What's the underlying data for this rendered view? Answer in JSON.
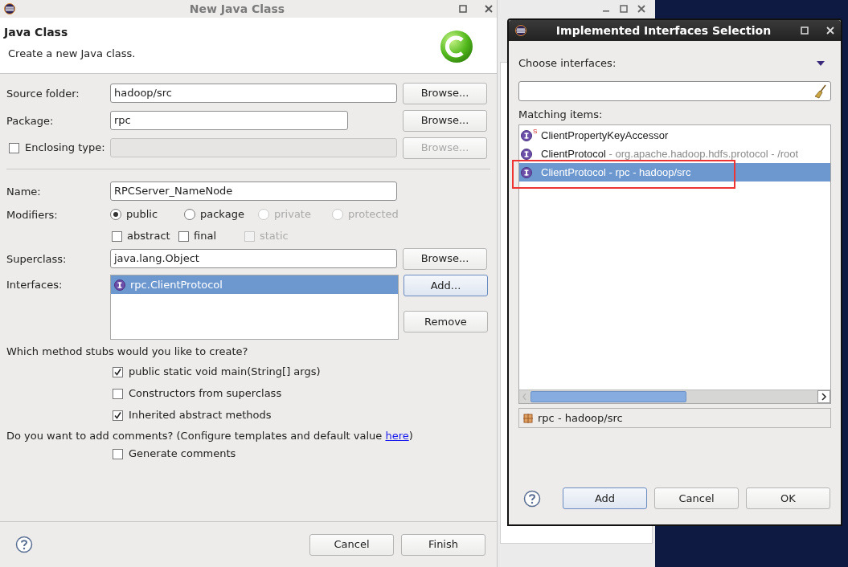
{
  "main_dialog": {
    "title": "New Java Class",
    "header": {
      "title": "Java Class",
      "description": "Create a new Java class."
    },
    "source_folder": {
      "label": "Source folder:",
      "value": "hadoop/src",
      "button": {
        "label": "Browse...",
        "disabled": false,
        "focused": false
      }
    },
    "package": {
      "label": "Package:",
      "value": "rpc",
      "button": {
        "label": "Browse...",
        "disabled": false,
        "focused": false
      }
    },
    "enclosing_type": {
      "label": "Enclosing type:",
      "checked": false,
      "disabled": true,
      "button": {
        "label": "Browse...",
        "disabled": true,
        "focused": false
      }
    },
    "name": {
      "label": "Name:",
      "value": "RPCServer_NameNode"
    },
    "modifiers": {
      "label": "Modifiers:",
      "access": [
        {
          "label": "public",
          "selected": true,
          "disabled": false
        },
        {
          "label": "package",
          "selected": false,
          "disabled": false
        },
        {
          "label": "private",
          "selected": false,
          "disabled": true
        },
        {
          "label": "protected",
          "selected": false,
          "disabled": true
        }
      ],
      "flags": [
        {
          "label": "abstract",
          "checked": false,
          "disabled": false
        },
        {
          "label": "final",
          "checked": false,
          "disabled": false
        },
        {
          "label": "static",
          "checked": false,
          "disabled": true
        }
      ]
    },
    "superclass": {
      "label": "Superclass:",
      "value": "java.lang.Object",
      "button": {
        "label": "Browse...",
        "disabled": false,
        "focused": false
      }
    },
    "interfaces": {
      "label": "Interfaces:",
      "items": [
        {
          "label": "rpc.ClientProtocol",
          "selected": true
        }
      ],
      "buttons": [
        {
          "label": "Add...",
          "disabled": false,
          "focused": true
        },
        {
          "label": "Remove",
          "disabled": false,
          "focused": false
        }
      ]
    },
    "stubs": {
      "question": "Which method stubs would you like to create?",
      "options": [
        {
          "label": "public static void main(String[] args)",
          "checked": true
        },
        {
          "label": "Constructors from superclass",
          "checked": false
        },
        {
          "label": "Inherited abstract methods",
          "checked": true
        }
      ]
    },
    "comments": {
      "before": "Do you want to add comments? (Configure templates and default value ",
      "link": "here",
      "after": ")",
      "option": {
        "label": "Generate comments",
        "checked": false
      }
    },
    "buttons": [
      {
        "label": "Cancel",
        "disabled": false,
        "focused": false
      },
      {
        "label": "Finish",
        "disabled": false,
        "focused": false
      }
    ]
  },
  "selection_dialog": {
    "title": "Implemented Interfaces Selection",
    "filter_label": "Choose interfaces:",
    "list_label": "Matching items:",
    "items": [
      {
        "name": "ClientPropertyKeyAccessor",
        "decorator": "S",
        "selected": false,
        "highlighted": false
      },
      {
        "name": "ClientProtocol",
        "qualifier": " - org.apache.hadoop.hdfs.protocol - /root",
        "selected": false,
        "highlighted": false
      },
      {
        "name": "ClientProtocol",
        "qualifier": " - rpc - hadoop/src",
        "selected": true,
        "highlighted": true
      }
    ],
    "status": "rpc - hadoop/src",
    "buttons": [
      {
        "label": "Add",
        "disabled": false,
        "focused": true
      },
      {
        "label": "Cancel",
        "disabled": false,
        "focused": false
      },
      {
        "label": "OK",
        "disabled": false,
        "focused": false
      }
    ]
  }
}
